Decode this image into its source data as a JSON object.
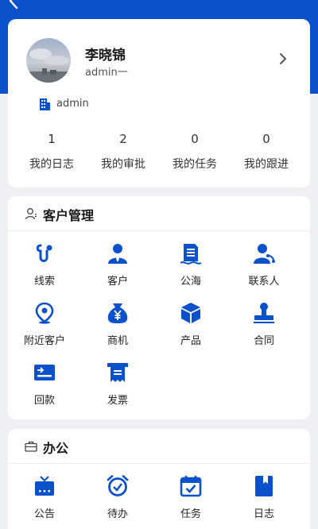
{
  "header": {
    "back_icon": "chevron-left-icon"
  },
  "colors": {
    "brand": "#0b51cc",
    "background": "#eef0f4",
    "card": "#ffffff"
  },
  "profile": {
    "name": "李晓锦",
    "account": "admin一",
    "org": "admin",
    "stats": [
      {
        "count": "1",
        "label": "我的日志"
      },
      {
        "count": "2",
        "label": "我的审批"
      },
      {
        "count": "0",
        "label": "我的任务"
      },
      {
        "count": "0",
        "label": "我的跟进"
      }
    ]
  },
  "crm": {
    "title": "客户管理",
    "items": [
      {
        "label": "线索",
        "icon": "clue-icon"
      },
      {
        "label": "客户",
        "icon": "customer-icon"
      },
      {
        "label": "公海",
        "icon": "public-pool-icon"
      },
      {
        "label": "联系人",
        "icon": "contact-icon"
      },
      {
        "label": "附近客户",
        "icon": "location-pin-icon"
      },
      {
        "label": "商机",
        "icon": "yen-bag-icon"
      },
      {
        "label": "产品",
        "icon": "product-box-icon"
      },
      {
        "label": "合同",
        "icon": "contract-stamp-icon"
      },
      {
        "label": "回款",
        "icon": "payment-card-icon"
      },
      {
        "label": "发票",
        "icon": "invoice-icon"
      }
    ]
  },
  "office": {
    "title": "办公",
    "items": [
      {
        "label": "公告",
        "icon": "announcement-icon"
      },
      {
        "label": "待办",
        "icon": "alarm-clock-icon"
      },
      {
        "label": "任务",
        "icon": "calendar-check-icon"
      },
      {
        "label": "日志",
        "icon": "log-book-icon"
      }
    ]
  }
}
